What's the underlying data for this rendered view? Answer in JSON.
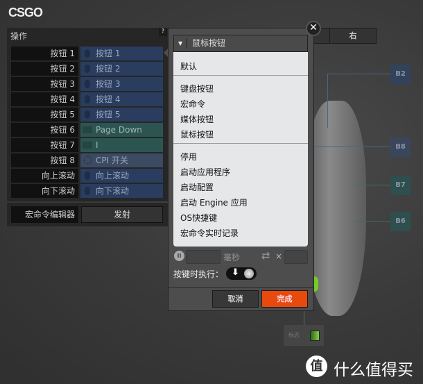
{
  "title": "CSGO",
  "panel": {
    "header": "操作",
    "help": "?",
    "rows": [
      {
        "label": "按钮 1",
        "value": "按钮 1",
        "type": "mouse"
      },
      {
        "label": "按钮 2",
        "value": "按钮 2",
        "type": "mouse"
      },
      {
        "label": "按钮 3",
        "value": "按钮 3",
        "type": "mouse"
      },
      {
        "label": "按钮 4",
        "value": "按钮 4",
        "type": "mouse"
      },
      {
        "label": "按钮 5",
        "value": "按钮 5",
        "type": "mouse"
      },
      {
        "label": "按钮 6",
        "value": "Page Down",
        "type": "key"
      },
      {
        "label": "按钮 7",
        "value": "I",
        "type": "key"
      },
      {
        "label": "按钮 8",
        "value": "CPI 开关",
        "type": "cpi"
      },
      {
        "label": "向上滚动",
        "value": "向上滚动",
        "type": "mouse"
      },
      {
        "label": "向下滚动",
        "value": "向下滚动",
        "type": "mouse"
      }
    ],
    "macro_label": "宏命令编辑器",
    "macro_button": "发射"
  },
  "popup": {
    "dropdown": "鼠标按钮",
    "close": "✕",
    "menu": [
      "默认",
      "键盘按钮",
      "宏命令",
      "媒体按钮",
      "鼠标按钮",
      "停用",
      "启动应用程序",
      "启动配置",
      "启动 Engine 应用",
      "OS快捷键",
      "宏命令实时记录"
    ],
    "ms_label": "毫秒",
    "repeat_x": "×",
    "exec_label": "按键时执行：",
    "cancel": "取消",
    "done": "完成"
  },
  "tabs": {
    "right": "右"
  },
  "device": {
    "buttons": [
      "B2",
      "B8",
      "B7",
      "B6"
    ],
    "logo_label": "标志"
  },
  "watermark": {
    "badge": "值",
    "text": "什么值得买"
  },
  "colors": {
    "accent": "#e8490d",
    "mouse_binding": "#2a3d5e",
    "key_binding": "#2c5552"
  }
}
